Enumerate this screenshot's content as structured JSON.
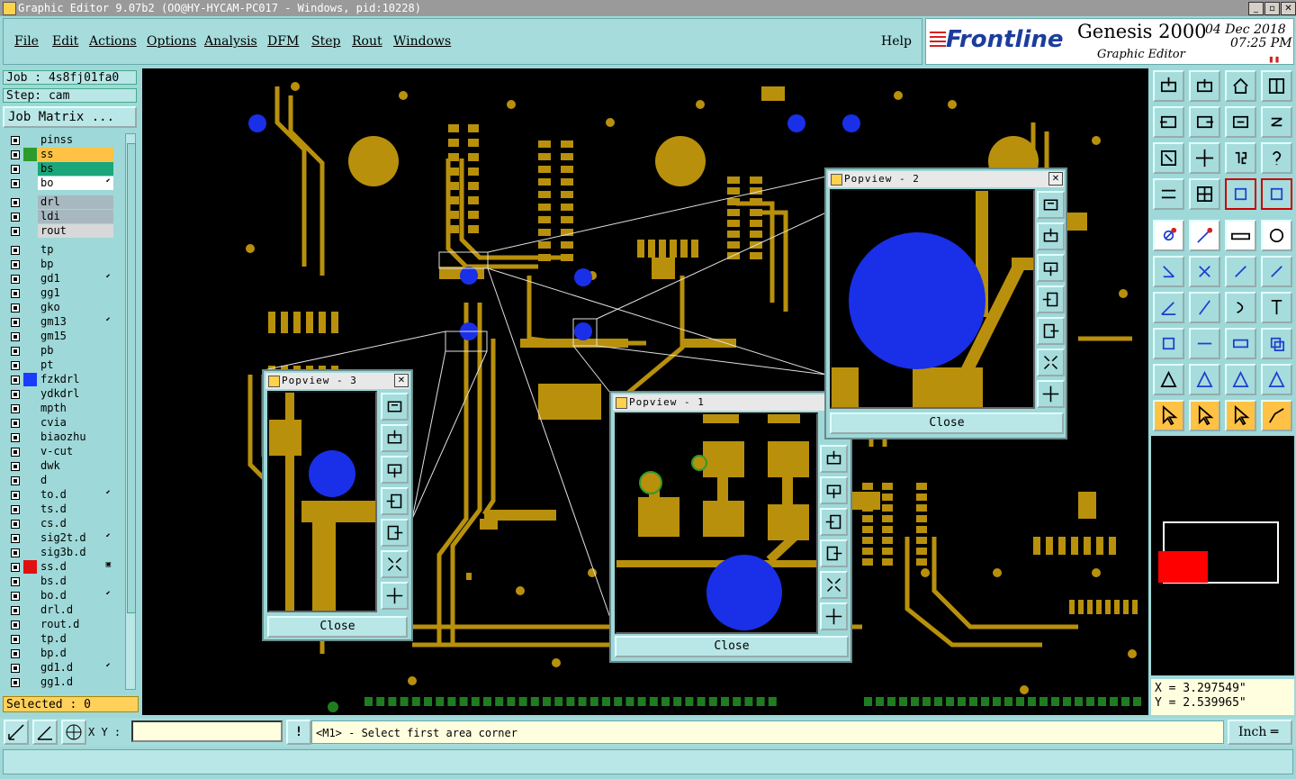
{
  "window": {
    "title": "Graphic Editor 9.07b2 (OO@HY-HYCAM-PC017 - Windows, pid:10228)",
    "min": "_",
    "max": "▫",
    "close": "✕"
  },
  "menu": {
    "file": "File",
    "edit": "Edit",
    "actions": "Actions",
    "options": "Options",
    "analysis": "Analysis",
    "dfm": "DFM",
    "step": "Step",
    "rout": "Rout",
    "windows": "Windows",
    "help": "Help"
  },
  "brand": {
    "logo": "Frontline",
    "product": "Genesis 2000",
    "subtitle": "Graphic Editor",
    "date": "04 Dec 2018",
    "time": "07:25 PM",
    "pause": "▮▮"
  },
  "job": {
    "job": "Job : 4s8fj01fa0",
    "step": "Step: cam",
    "matrix": "Job Matrix ..."
  },
  "layers": [
    {
      "name": "pinss",
      "color": "#9fd8d8",
      "sw": "",
      "flag": ""
    },
    {
      "name": "ss",
      "color": "#ffc244",
      "sw": "#2d9a2d",
      "flag": ""
    },
    {
      "name": "bs",
      "color": "#1aa57a",
      "sw": "",
      "flag": ""
    },
    {
      "name": "bo",
      "color": "#ffffff",
      "sw": "",
      "flag": "⬋"
    },
    {
      "name": "drl",
      "color": "#a7b8c0",
      "sw": "",
      "flag": ""
    },
    {
      "name": "ldi",
      "color": "#a7b8c0",
      "sw": "",
      "flag": ""
    },
    {
      "name": "rout",
      "color": "#d8d8d8",
      "sw": "",
      "flag": ""
    },
    {
      "name": "tp",
      "color": "#9fd8d8",
      "sw": "",
      "flag": ""
    },
    {
      "name": "bp",
      "color": "#9fd8d8",
      "sw": "",
      "flag": ""
    },
    {
      "name": "gd1",
      "color": "#9fd8d8",
      "sw": "",
      "flag": "⬋"
    },
    {
      "name": "gg1",
      "color": "#9fd8d8",
      "sw": "",
      "flag": ""
    },
    {
      "name": "gko",
      "color": "#9fd8d8",
      "sw": "",
      "flag": ""
    },
    {
      "name": "gm13",
      "color": "#9fd8d8",
      "sw": "",
      "flag": "⬋"
    },
    {
      "name": "gm15",
      "color": "#9fd8d8",
      "sw": "",
      "flag": ""
    },
    {
      "name": "pb",
      "color": "#9fd8d8",
      "sw": "",
      "flag": ""
    },
    {
      "name": "pt",
      "color": "#9fd8d8",
      "sw": "",
      "flag": ""
    },
    {
      "name": "fzkdrl",
      "color": "#9fd8d8",
      "sw": "#1a3cff",
      "flag": ""
    },
    {
      "name": "ydkdrl",
      "color": "#9fd8d8",
      "sw": "",
      "flag": ""
    },
    {
      "name": "mpth",
      "color": "#9fd8d8",
      "sw": "",
      "flag": ""
    },
    {
      "name": "cvia",
      "color": "#9fd8d8",
      "sw": "",
      "flag": ""
    },
    {
      "name": "biaozhu",
      "color": "#9fd8d8",
      "sw": "",
      "flag": ""
    },
    {
      "name": "v-cut",
      "color": "#9fd8d8",
      "sw": "",
      "flag": ""
    },
    {
      "name": "dwk",
      "color": "#9fd8d8",
      "sw": "",
      "flag": ""
    },
    {
      "name": "d",
      "color": "#9fd8d8",
      "sw": "",
      "flag": ""
    },
    {
      "name": "to.d",
      "color": "#9fd8d8",
      "sw": "",
      "flag": "⬋"
    },
    {
      "name": "ts.d",
      "color": "#9fd8d8",
      "sw": "",
      "flag": ""
    },
    {
      "name": "cs.d",
      "color": "#9fd8d8",
      "sw": "",
      "flag": ""
    },
    {
      "name": "sig2t.d",
      "color": "#9fd8d8",
      "sw": "",
      "flag": "⬋"
    },
    {
      "name": "sig3b.d",
      "color": "#9fd8d8",
      "sw": "",
      "flag": ""
    },
    {
      "name": "ss.d",
      "color": "#9fd8d8",
      "sw": "#e01010",
      "flag": "▣"
    },
    {
      "name": "bs.d",
      "color": "#9fd8d8",
      "sw": "",
      "flag": ""
    },
    {
      "name": "bo.d",
      "color": "#9fd8d8",
      "sw": "",
      "flag": "⬋"
    },
    {
      "name": "drl.d",
      "color": "#9fd8d8",
      "sw": "",
      "flag": ""
    },
    {
      "name": "rout.d",
      "color": "#9fd8d8",
      "sw": "",
      "flag": ""
    },
    {
      "name": "tp.d",
      "color": "#9fd8d8",
      "sw": "",
      "flag": ""
    },
    {
      "name": "bp.d",
      "color": "#9fd8d8",
      "sw": "",
      "flag": ""
    },
    {
      "name": "gd1.d",
      "color": "#9fd8d8",
      "sw": "",
      "flag": "⬋"
    },
    {
      "name": "gg1.d",
      "color": "#9fd8d8",
      "sw": "",
      "flag": ""
    }
  ],
  "selected": "Selected : 0",
  "popups": {
    "p1": {
      "title": "Popview - 1",
      "close": "Close"
    },
    "p2": {
      "title": "Popview - 2",
      "close": "Close"
    },
    "p3": {
      "title": "Popview - 3",
      "close": "Close"
    }
  },
  "coords": {
    "x": "X = 3.297549\"",
    "y": "Y = 2.539965\""
  },
  "bottom": {
    "xy_label": "X Y :",
    "xy_value": "",
    "warn": "!",
    "message": "<M1> - Select first area corner",
    "unit": "Inch ═"
  },
  "colors": {
    "copper": "#b8900c",
    "drill": "#1a2fe8",
    "accent": "#ffc244"
  }
}
